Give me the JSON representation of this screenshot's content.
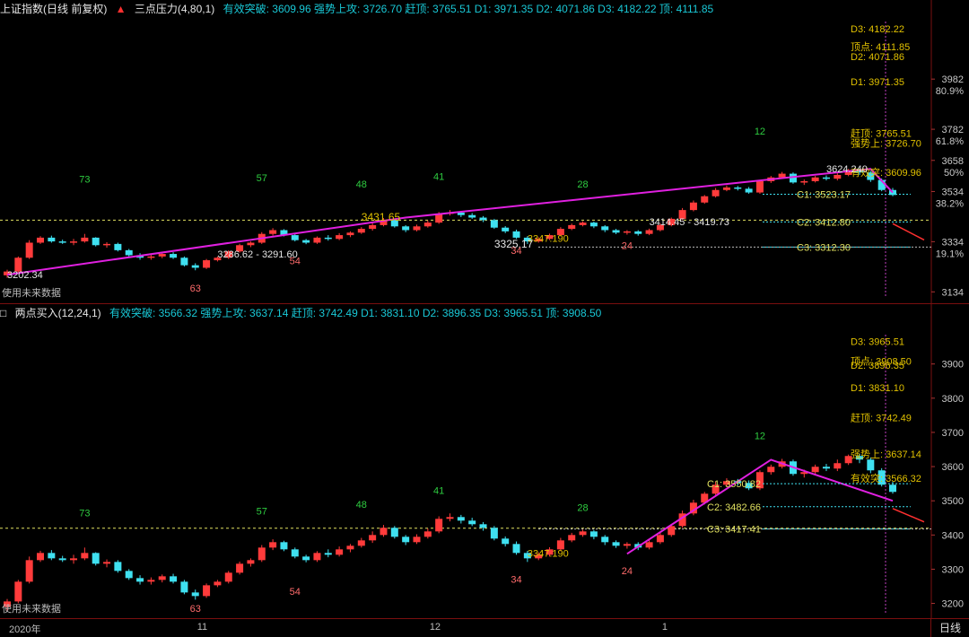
{
  "panels": [
    {
      "id": "top",
      "title": "上证指数(日线 前复权)",
      "indicator": "三点压力(4,80,1)",
      "summary": "有效突破: 3609.96  强势上攻: 3726.70  赶顶: 3765.51  D1: 3971.35  D2: 4071.86  D3: 4182.22  顶: 4111.85",
      "yaxis": [
        {
          "v": 3982,
          "label": "3982",
          "pct": "80.9%"
        },
        {
          "v": 3782,
          "label": "3782",
          "pct": "61.8%"
        },
        {
          "v": 3658,
          "label": "3658",
          "pct": "50%"
        },
        {
          "v": 3534,
          "label": "3534",
          "pct": "38.2%"
        },
        {
          "v": 3334,
          "label": "3334",
          "pct": "19.1%"
        },
        {
          "v": 3134,
          "label": "3134",
          "pct": ""
        }
      ],
      "ymin": 3110,
      "ymax": 4190,
      "right_labels": [
        {
          "v": 4182.22,
          "text": "D3: 4182.22",
          "color": "#e0c000"
        },
        {
          "v": 4111.85,
          "text": "顶点: 4111.85",
          "color": "#e0c000"
        },
        {
          "v": 4071.86,
          "text": "D2: 4071.86",
          "color": "#e0c000"
        },
        {
          "v": 3971.35,
          "text": "D1: 3971.35",
          "color": "#e0c000"
        },
        {
          "v": 3765.51,
          "text": "赶顶: 3765.51",
          "color": "#e0c000"
        },
        {
          "v": 3726.7,
          "text": "强势上: 3726.70",
          "color": "#e0c000"
        },
        {
          "v": 3609.96,
          "text": "有效突: 3609.96",
          "color": "#e0c000"
        }
      ],
      "c_labels": [
        {
          "v": 3523.17,
          "text": "C1: 3523.17"
        },
        {
          "v": 3412.8,
          "text": "C2: 3412.80"
        },
        {
          "v": 3312.3,
          "text": "C3: 3312.30"
        }
      ],
      "annotations": [
        {
          "text": "3202.34",
          "i": 0,
          "v": 3202.34,
          "color": "#e6e6e6"
        },
        {
          "text": "3286.62 - 3291.60",
          "i": 19,
          "v": 3286,
          "color": "#e6e6e6"
        },
        {
          "text": "3431.65",
          "i": 32,
          "v": 3431.65,
          "color": "#e0c000"
        },
        {
          "text": "3347.190",
          "i": 47,
          "v": 3347.19,
          "color": "#e0c000"
        },
        {
          "text": "3325.17",
          "i": 44,
          "v": 3325.17,
          "color": "#e6e6e6"
        },
        {
          "text": "3414.45 - 3419.73",
          "i": 58,
          "v": 3414.45,
          "color": "#e6e6e6"
        },
        {
          "text": "3624.240",
          "i": 74,
          "v": 3624.24,
          "color": "#e6e6e6"
        }
      ],
      "counts": [
        {
          "text": "73",
          "i": 7,
          "v": 3570,
          "color": "#2ecc40"
        },
        {
          "text": "57",
          "i": 23,
          "v": 3575,
          "color": "#2ecc40"
        },
        {
          "text": "48",
          "i": 32,
          "v": 3550,
          "color": "#2ecc40"
        },
        {
          "text": "41",
          "i": 39,
          "v": 3580,
          "color": "#2ecc40"
        },
        {
          "text": "28",
          "i": 52,
          "v": 3550,
          "color": "#2ecc40"
        },
        {
          "text": "12",
          "i": 68,
          "v": 3760,
          "color": "#2ecc40"
        },
        {
          "text": "63",
          "i": 17,
          "v": 3135,
          "color": "#ff6b6b"
        },
        {
          "text": "54",
          "i": 26,
          "v": 3245,
          "color": "#ff6b6b"
        },
        {
          "text": "34",
          "i": 46,
          "v": 3285,
          "color": "#ff6b6b"
        },
        {
          "text": "24",
          "i": 56,
          "v": 3305,
          "color": "#ff6b6b"
        }
      ],
      "footer_note": "使用未来数据"
    },
    {
      "id": "bottom",
      "indicator": "两点买入(12,24,1)",
      "summary": "有效突破: 3566.32  强势上攻: 3637.14  赶顶: 3742.49  D1: 3831.10  D2: 3896.35  D3: 3965.51  顶: 3908.50",
      "yaxis": [
        {
          "v": 3900,
          "label": "3900",
          "pct": ""
        },
        {
          "v": 3800,
          "label": "3800",
          "pct": ""
        },
        {
          "v": 3700,
          "label": "3700",
          "pct": ""
        },
        {
          "v": 3600,
          "label": "3600",
          "pct": ""
        },
        {
          "v": 3500,
          "label": "3500",
          "pct": ""
        },
        {
          "v": 3400,
          "label": "3400",
          "pct": ""
        },
        {
          "v": 3300,
          "label": "3300",
          "pct": ""
        },
        {
          "v": 3200,
          "label": "3200",
          "pct": ""
        }
      ],
      "ymin": 3170,
      "ymax": 3970,
      "right_labels": [
        {
          "v": 3965.51,
          "text": "D3: 3965.51",
          "color": "#e0c000"
        },
        {
          "v": 3908.5,
          "text": "顶点: 3908.50",
          "color": "#e0c000"
        },
        {
          "v": 3896.35,
          "text": "D2: 3896.35",
          "color": "#e0c000"
        },
        {
          "v": 3831.1,
          "text": "D1: 3831.10",
          "color": "#e0c000"
        },
        {
          "v": 3742.49,
          "text": "赶顶: 3742.49",
          "color": "#e0c000"
        },
        {
          "v": 3637.14,
          "text": "强势上: 3637.14",
          "color": "#e0c000"
        },
        {
          "v": 3566.32,
          "text": "有效突: 3566.32",
          "color": "#e0c000"
        }
      ],
      "c_labels": [
        {
          "v": 3550,
          "text": "C1: 3550.82"
        },
        {
          "v": 3482.66,
          "text": "C2: 3482.66"
        },
        {
          "v": 3417.41,
          "text": "C3: 3417.41"
        }
      ],
      "annotations": [
        {
          "text": "3347.190",
          "i": 47,
          "v": 3347.19,
          "color": "#e0c000"
        }
      ],
      "counts": [
        {
          "text": "73",
          "i": 7,
          "v": 3455,
          "color": "#2ecc40"
        },
        {
          "text": "57",
          "i": 23,
          "v": 3460,
          "color": "#2ecc40"
        },
        {
          "text": "48",
          "i": 32,
          "v": 3480,
          "color": "#2ecc40"
        },
        {
          "text": "41",
          "i": 39,
          "v": 3520,
          "color": "#2ecc40"
        },
        {
          "text": "28",
          "i": 52,
          "v": 3470,
          "color": "#2ecc40"
        },
        {
          "text": "12",
          "i": 68,
          "v": 3680,
          "color": "#2ecc40"
        },
        {
          "text": "63",
          "i": 17,
          "v": 3175,
          "color": "#ff6b6b"
        },
        {
          "text": "54",
          "i": 26,
          "v": 3225,
          "color": "#ff6b6b"
        },
        {
          "text": "34",
          "i": 46,
          "v": 3260,
          "color": "#ff6b6b"
        },
        {
          "text": "24",
          "i": 56,
          "v": 3285,
          "color": "#ff6b6b"
        }
      ],
      "footer_note": "使用未来数据"
    }
  ],
  "xaxis": {
    "labels": [
      {
        "i": 0,
        "text": "2020年"
      },
      {
        "i": 17,
        "text": "11"
      },
      {
        "i": 38,
        "text": "12"
      },
      {
        "i": 59,
        "text": "1"
      }
    ]
  },
  "period_button": "日线",
  "colors": {
    "up": "#ff3b3b",
    "down": "#3fe0f0",
    "trend": "#e020e0",
    "dash": "#e0e060",
    "grid_red": "#7a0f0f"
  },
  "chart_data": [
    {
      "type": "candlestick",
      "title": "上证指数(日线 前复权)",
      "indicator": "三点压力(4,80,1)",
      "ylim": [
        3110,
        4190
      ],
      "xlabel": "",
      "ylabel": "",
      "legend": "top-left",
      "candles": [
        [
          3200,
          3215,
          3190,
          3222
        ],
        [
          3215,
          3270,
          3210,
          3275
        ],
        [
          3270,
          3330,
          3265,
          3340
        ],
        [
          3330,
          3350,
          3325,
          3356
        ],
        [
          3350,
          3335,
          3330,
          3358
        ],
        [
          3335,
          3330,
          3325,
          3342
        ],
        [
          3330,
          3335,
          3320,
          3345
        ],
        [
          3335,
          3350,
          3330,
          3365
        ],
        [
          3350,
          3320,
          3315,
          3352
        ],
        [
          3320,
          3325,
          3310,
          3332
        ],
        [
          3325,
          3300,
          3295,
          3330
        ],
        [
          3300,
          3280,
          3275,
          3305
        ],
        [
          3280,
          3270,
          3262,
          3288
        ],
        [
          3270,
          3275,
          3262,
          3282
        ],
        [
          3275,
          3285,
          3268,
          3290
        ],
        [
          3285,
          3270,
          3265,
          3292
        ],
        [
          3270,
          3240,
          3235,
          3275
        ],
        [
          3240,
          3230,
          3220,
          3248
        ],
        [
          3230,
          3260,
          3225,
          3265
        ],
        [
          3260,
          3270,
          3255,
          3275
        ],
        [
          3270,
          3295,
          3265,
          3300
        ],
        [
          3295,
          3320,
          3290,
          3326
        ],
        [
          3320,
          3330,
          3312,
          3335
        ],
        [
          3330,
          3365,
          3325,
          3372
        ],
        [
          3365,
          3380,
          3358,
          3388
        ],
        [
          3380,
          3360,
          3355,
          3384
        ],
        [
          3360,
          3340,
          3335,
          3365
        ],
        [
          3340,
          3330,
          3324,
          3345
        ],
        [
          3330,
          3350,
          3325,
          3355
        ],
        [
          3350,
          3345,
          3338,
          3360
        ],
        [
          3345,
          3360,
          3340,
          3368
        ],
        [
          3360,
          3370,
          3352,
          3375
        ],
        [
          3370,
          3385,
          3365,
          3392
        ],
        [
          3385,
          3400,
          3378,
          3410
        ],
        [
          3400,
          3420,
          3395,
          3428
        ],
        [
          3420,
          3395,
          3390,
          3425
        ],
        [
          3395,
          3380,
          3372,
          3400
        ],
        [
          3380,
          3395,
          3375,
          3402
        ],
        [
          3395,
          3410,
          3390,
          3418
        ],
        [
          3410,
          3445,
          3405,
          3452
        ],
        [
          3445,
          3450,
          3438,
          3460
        ],
        [
          3450,
          3440,
          3432,
          3456
        ],
        [
          3440,
          3430,
          3425,
          3448
        ],
        [
          3430,
          3420,
          3412,
          3436
        ],
        [
          3420,
          3390,
          3385,
          3425
        ],
        [
          3390,
          3375,
          3368,
          3396
        ],
        [
          3375,
          3350,
          3345,
          3382
        ],
        [
          3350,
          3335,
          3325,
          3356
        ],
        [
          3335,
          3345,
          3330,
          3352
        ],
        [
          3345,
          3360,
          3340,
          3366
        ],
        [
          3360,
          3385,
          3355,
          3392
        ],
        [
          3385,
          3400,
          3380,
          3406
        ],
        [
          3400,
          3410,
          3395,
          3415
        ],
        [
          3410,
          3395,
          3388,
          3414
        ],
        [
          3395,
          3380,
          3372,
          3400
        ],
        [
          3380,
          3370,
          3364,
          3385
        ],
        [
          3370,
          3375,
          3362,
          3380
        ],
        [
          3375,
          3365,
          3358,
          3380
        ],
        [
          3365,
          3380,
          3360,
          3386
        ],
        [
          3380,
          3400,
          3375,
          3406
        ],
        [
          3400,
          3425,
          3395,
          3430
        ],
        [
          3425,
          3460,
          3420,
          3468
        ],
        [
          3460,
          3490,
          3455,
          3498
        ],
        [
          3490,
          3515,
          3485,
          3520
        ],
        [
          3515,
          3540,
          3510,
          3548
        ],
        [
          3540,
          3550,
          3535,
          3558
        ],
        [
          3550,
          3545,
          3538,
          3556
        ],
        [
          3545,
          3530,
          3525,
          3552
        ],
        [
          3530,
          3575,
          3525,
          3580
        ],
        [
          3575,
          3590,
          3568,
          3596
        ],
        [
          3590,
          3605,
          3585,
          3612
        ],
        [
          3605,
          3570,
          3565,
          3610
        ],
        [
          3570,
          3575,
          3560,
          3582
        ],
        [
          3575,
          3590,
          3570,
          3596
        ],
        [
          3590,
          3585,
          3578,
          3598
        ],
        [
          3585,
          3600,
          3578,
          3610
        ],
        [
          3600,
          3620,
          3595,
          3624
        ],
        [
          3620,
          3610,
          3600,
          3626
        ],
        [
          3610,
          3580,
          3572,
          3616
        ],
        [
          3580,
          3540,
          3535,
          3586
        ],
        [
          3540,
          3520,
          3515,
          3548
        ]
      ]
    }
  ]
}
